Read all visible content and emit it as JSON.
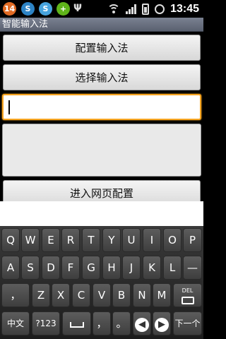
{
  "status_bar": {
    "badge_count": "14",
    "app_icon_1": "S",
    "app_icon_2": "S",
    "app_icon_3": "+",
    "time": "13:45",
    "icons": [
      "notification-badge-icon",
      "s-app-icon",
      "s-app-icon-2",
      "green-cross-icon",
      "usb-icon",
      "wifi-icon",
      "signal-icon",
      "battery-icon",
      "alarm-icon"
    ]
  },
  "title_bar": {
    "title": "智能输入法"
  },
  "main": {
    "configure_button": "配置输入法",
    "select_button": "选择输入法",
    "text_input_value": "",
    "text_area_value": "",
    "web_config_button": "进入网页配置"
  },
  "keyboard": {
    "row1": [
      "Q",
      "W",
      "E",
      "R",
      "T",
      "Y",
      "U",
      "I",
      "O",
      "P"
    ],
    "row2": [
      "A",
      "S",
      "D",
      "F",
      "G",
      "H",
      "J",
      "K",
      "L",
      "—"
    ],
    "row3": [
      "，",
      "Z",
      "X",
      "C",
      "V",
      "B",
      "N",
      "M"
    ],
    "delete_label": "DEL",
    "row4": {
      "lang": "中文",
      "symbols": "?123",
      "comma": "，",
      "period": "。",
      "next": "下一个"
    }
  },
  "colors": {
    "focus_border": "#f7a521",
    "title_bar": "#6b7281"
  }
}
